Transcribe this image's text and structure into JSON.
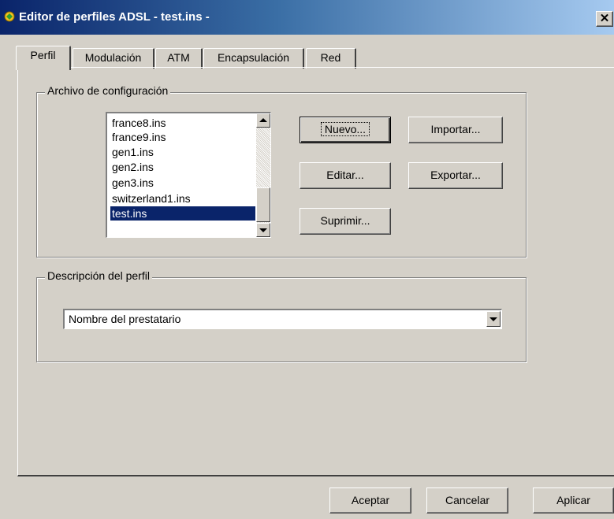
{
  "window": {
    "title": "Editor de perfiles ADSL - test.ins -",
    "close_glyph": "✕"
  },
  "tabs": [
    {
      "label": "Perfil",
      "active": true
    },
    {
      "label": "Modulación",
      "active": false
    },
    {
      "label": "ATM",
      "active": false
    },
    {
      "label": "Encapsulación",
      "active": false
    },
    {
      "label": "Red",
      "active": false
    }
  ],
  "config_group": {
    "label": "Archivo de configuración",
    "files": [
      "france8.ins",
      "france9.ins",
      "gen1.ins",
      "gen2.ins",
      "gen3.ins",
      "switzerland1.ins",
      "test.ins"
    ],
    "selected": "test.ins",
    "buttons": {
      "new": "Nuevo...",
      "import": "Importar...",
      "edit": "Editar...",
      "export": "Exportar...",
      "delete": "Suprimir..."
    }
  },
  "profile_group": {
    "label": "Descripción del perfil",
    "combo_value": "Nombre del prestatario"
  },
  "footer": {
    "ok": "Aceptar",
    "cancel": "Cancelar",
    "apply": "Aplicar"
  },
  "colors": {
    "selection": "#0a246a",
    "face": "#d4d0c8"
  },
  "icons": {
    "title": "adsl-app-icon",
    "close": "close-icon"
  }
}
